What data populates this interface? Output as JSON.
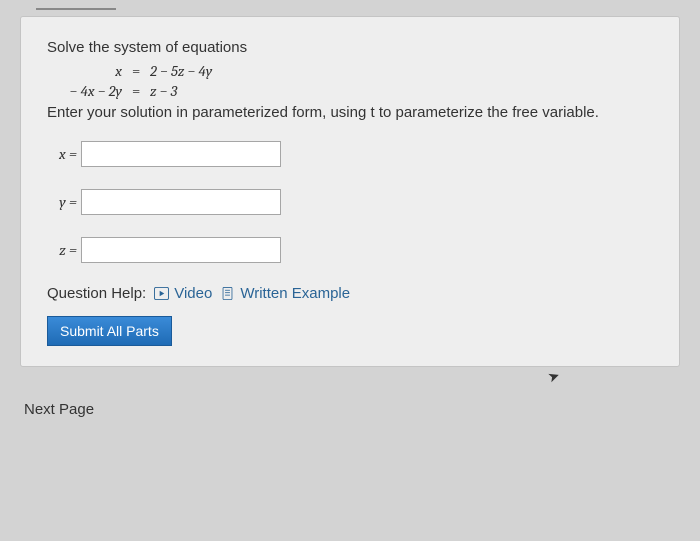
{
  "question": {
    "prompt": "Solve the system of equations",
    "eq1": {
      "lhs": "x",
      "eq": "=",
      "rhs": "2 − 5z − 4y"
    },
    "eq2": {
      "lhs": "− 4x − 2y",
      "eq": "=",
      "rhs": "z − 3"
    },
    "instruction": "Enter your solution in parameterized form, using t to parameterize the free variable.",
    "answers": {
      "x_label": "x =",
      "y_label": "y =",
      "z_label": "z =",
      "x_value": "",
      "y_value": "",
      "z_value": ""
    },
    "help": {
      "label": "Question Help:",
      "video": "Video",
      "written": "Written Example"
    },
    "submit_label": "Submit All Parts"
  },
  "nav": {
    "next_label": "Next Page"
  }
}
